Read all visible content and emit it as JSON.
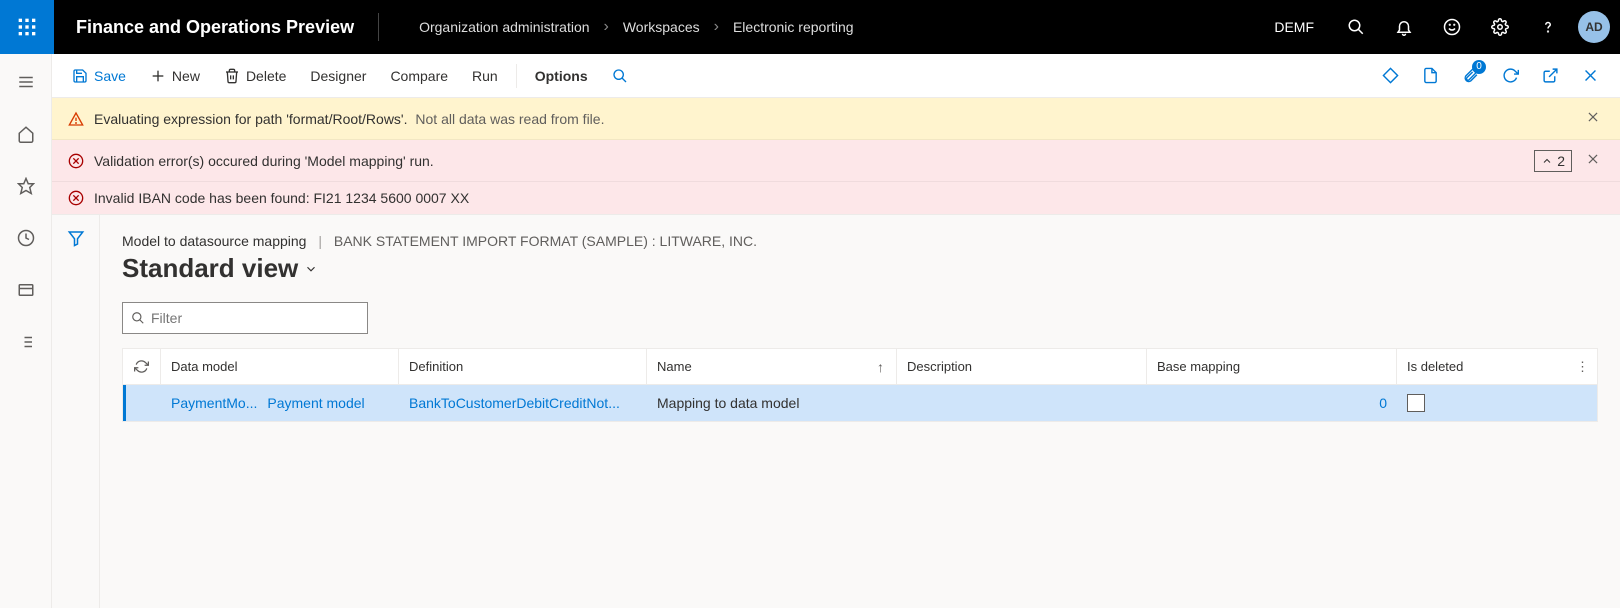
{
  "header": {
    "app_title": "Finance and Operations Preview",
    "breadcrumb": [
      "Organization administration",
      "Workspaces",
      "Electronic reporting"
    ],
    "company": "DEMF",
    "avatar": "AD"
  },
  "commands": {
    "save": "Save",
    "new": "New",
    "delete": "Delete",
    "designer": "Designer",
    "compare": "Compare",
    "run": "Run",
    "options": "Options",
    "attach_badge": "0"
  },
  "messages": {
    "warn_main": "Evaluating expression for path 'format/Root/Rows'.",
    "warn_extra": "Not all data was read from file.",
    "err_group": "Validation error(s) occured during 'Model mapping' run.",
    "err_group_count": "2",
    "err_detail": "Invalid IBAN code has been found: FI21 1234 5600 0007 XX"
  },
  "page": {
    "crumb_main": "Model to datasource mapping",
    "crumb_sub": "BANK STATEMENT IMPORT FORMAT (SAMPLE) : LITWARE, INC.",
    "view_title": "Standard view",
    "filter_placeholder": "Filter"
  },
  "grid": {
    "columns": {
      "data_model": "Data model",
      "definition": "Definition",
      "name": "Name",
      "description": "Description",
      "base_mapping": "Base mapping",
      "is_deleted": "Is deleted"
    },
    "row": {
      "data_model_short": "PaymentMo...",
      "data_model_full": "Payment model",
      "definition": "BankToCustomerDebitCreditNot...",
      "name": "Mapping to data model",
      "description": "",
      "base_mapping": "0",
      "is_deleted": false
    }
  }
}
